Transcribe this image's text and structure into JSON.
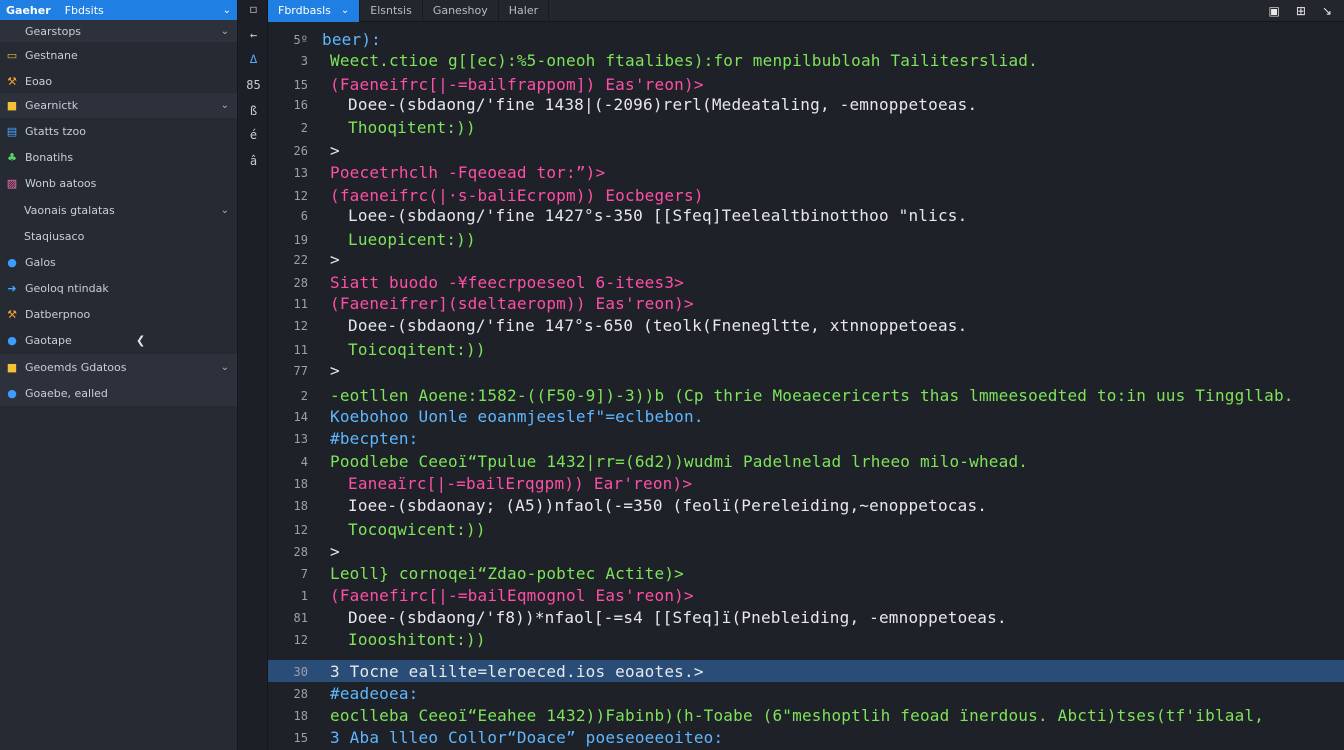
{
  "sidebar": {
    "header": {
      "title": "Gaeher",
      "subtitle": "Fbdsits"
    },
    "items": [
      {
        "label": "Gearstops",
        "icon": "none-icon",
        "kind": "section",
        "chevron": true
      },
      {
        "label": "Gestnane",
        "icon": "folder-icon",
        "kind": "item"
      },
      {
        "label": "Eoao",
        "icon": "tools-icon",
        "kind": "item"
      },
      {
        "label": "Gearnictk",
        "icon": "package-icon",
        "kind": "section",
        "chevron": true
      },
      {
        "label": "Gtatts tzoo",
        "icon": "chart-icon",
        "kind": "item"
      },
      {
        "label": "Bonatihs",
        "icon": "leaf-icon",
        "kind": "item"
      },
      {
        "label": "Wonb aatoos",
        "icon": "image-icon",
        "kind": "item"
      },
      {
        "label": "Vaonais gtalatas",
        "icon": "none-icon",
        "kind": "item",
        "chevron": true
      },
      {
        "label": "Staqiusaco",
        "icon": "none-icon",
        "kind": "item"
      },
      {
        "label": "Galos",
        "icon": "globe-icon",
        "kind": "item"
      },
      {
        "label": "Geoloq ntindak",
        "icon": "arrow-icon",
        "kind": "item"
      },
      {
        "label": "Datberpnoo",
        "icon": "tools-icon",
        "kind": "item"
      },
      {
        "label": "Gaotape",
        "icon": "globe-icon",
        "kind": "item",
        "arrow": true
      },
      {
        "label": "Geoemds Gdatoos",
        "icon": "package-icon",
        "kind": "section",
        "chevron": true
      },
      {
        "label": "Goaebe, ealled",
        "icon": "globe-icon",
        "kind": "section"
      }
    ]
  },
  "activity": [
    "◻",
    "←",
    "∆",
    "85",
    "ß",
    "é",
    "â"
  ],
  "tabs": [
    {
      "label": "Fbrdbasls",
      "active": true,
      "chevron": true
    },
    {
      "label": "Elsntsis"
    },
    {
      "label": "Ganeshoy"
    },
    {
      "label": "Haler"
    }
  ],
  "window_controls": [
    "▣",
    "⊞",
    "↘"
  ],
  "colors": {
    "green": "#7ee35a",
    "magenta": "#ff4fa8",
    "white": "#e6e8eb",
    "blue": "#5fb7ff",
    "highlight": "#2a4d78"
  },
  "editor_lines": [
    {
      "n": "5º",
      "t": "beer):",
      "c": "b",
      "i": 0
    },
    {
      "n": "3",
      "t": "Weect.ctioe g[[ec):%5-oneoh ftaalibes):for menpilbubloah Tailitesrsliad.",
      "c": "g",
      "i": 1,
      "tail": "w"
    },
    {
      "n": "15",
      "t": "(Faeneifrc[|-=bailfrappom]) Eas'reon)>",
      "c": "m",
      "i": 1
    },
    {
      "n": "16",
      "t": "Doee-(sbdaong/'fine 1438|(-2096)rerl(Medeataling, -emnoppetoeas.",
      "c": "w",
      "i": 2
    },
    {
      "n": "2",
      "t": "Thooqitent:))",
      "c": "g",
      "i": 2
    },
    {
      "n": "26",
      "t": ">",
      "c": "w",
      "i": 1
    },
    {
      "n": "13",
      "t": "Poecetrhclh -Fqeoead tor:”)>",
      "c": "m",
      "i": 1
    },
    {
      "n": "12",
      "t": "(faeneifrc(|·s-baliEcropm)) Eocbegers)",
      "c": "m",
      "i": 1
    },
    {
      "n": "6",
      "t": "Loee-(sbdaong/'fine 1427°s-350 [[Sfeq]Teelealtbinotthoo \"nlics.",
      "c": "w",
      "i": 2
    },
    {
      "n": "19",
      "t": "Lueopicent:))",
      "c": "g",
      "i": 2
    },
    {
      "n": "22",
      "t": ">",
      "c": "w",
      "i": 1
    },
    {
      "n": "28",
      "t": "Siatt buodo -¥feecrpoeseol 6-itees3>",
      "c": "m",
      "i": 1
    },
    {
      "n": "11",
      "t": "(Faeneifrer](sdeltaeropm)) Eas'reon)>",
      "c": "m",
      "i": 1
    },
    {
      "n": "12",
      "t": "Doee-(sbdaong/'fine 147°s-650 (teolk(Fnenegltte, xtnnoppetoeas.",
      "c": "w",
      "i": 2
    },
    {
      "n": "11",
      "t": "Toicoqitent:))",
      "c": "g",
      "i": 2
    },
    {
      "n": "77",
      "t": ">",
      "c": "w",
      "i": 1
    },
    {
      "n": "2",
      "t": "-eotllen Aoene:1582-((F50-9])-3))b (Cp thrie Moeaecericerts thas lmmeesoedted to:in uus Tinggllab.",
      "c": "g",
      "i": 1,
      "tail": "w"
    },
    {
      "n": "14",
      "t": "Koebohoo Uonle eoanmjeeslef\"=eclbebon.",
      "c": "b",
      "i": 1
    },
    {
      "n": "13",
      "t": "#becpten:",
      "c": "b",
      "i": 1
    },
    {
      "n": "4",
      "t": "Poodlebe Ceeoï“Tpulue 1432|rr=(6d2))wudmi Padelnelad lrheeo milo-whead.",
      "c": "g",
      "i": 1,
      "tail": "w"
    },
    {
      "n": "18",
      "t": "Eaneaïrc[|-=bailErqgpm)) Ear'reon)>",
      "c": "m",
      "i": 2
    },
    {
      "n": "18",
      "t": "Ioee-(sbdaonay; (A5))nfaol(-=350 (feolï(Pereleiding,~enoppetocas.",
      "c": "w",
      "i": 2
    },
    {
      "n": "12",
      "t": "Tocoqwicent:))",
      "c": "g",
      "i": 2
    },
    {
      "n": "28",
      "t": ">",
      "c": "w",
      "i": 1
    },
    {
      "n": "7",
      "t": "Leoll} cornoqei“Zdao-pobtec Actite)>",
      "c": "g",
      "i": 1,
      "tail": "m"
    },
    {
      "n": "1",
      "t": "(Faenefirc[|-=bailEqmognol Eas'reon)>",
      "c": "m",
      "i": 1
    },
    {
      "n": "81",
      "t": "Doee-(sbdaong/'f8))*nfaol[-=s4 [[Sfeq]ï(Pnebleiding, -emnoppetoeas.",
      "c": "w",
      "i": 2
    },
    {
      "n": "12",
      "t": "Ioooshitont:))",
      "c": "g",
      "i": 2
    },
    {
      "n": "30",
      "t": "3 Tocne ealilte=leroeced.ios eoaotes.>",
      "c": "w",
      "i": 1,
      "highlight": true
    },
    {
      "n": "28",
      "t": "#eadeoea:",
      "c": "b",
      "i": 1
    },
    {
      "n": "18",
      "t": "eoclleba Ceeoï“Eeahee 1432))Fabinb)(h-Toabe (6\"meshoptlih feoad ïnerdous. Abcti)tses(tf'iblaal,",
      "c": "g",
      "i": 1,
      "tail": "w"
    },
    {
      "n": "15",
      "t": "3 Aba llleo Collor“Doace” poeseoeeoiteo:",
      "c": "b",
      "i": 1
    }
  ]
}
